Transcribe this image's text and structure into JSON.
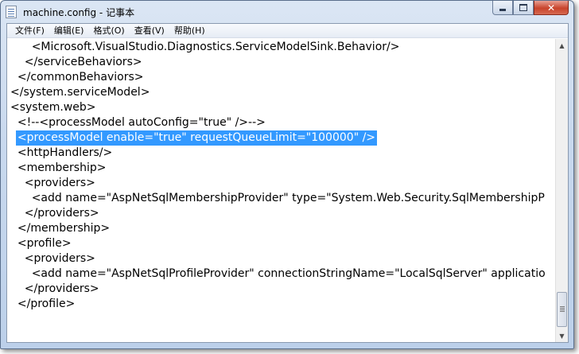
{
  "window": {
    "title": "machine.config - 记事本"
  },
  "titlebar_buttons": {
    "minimize": "minimize-icon",
    "maximize": "maximize-icon",
    "close": "close-icon"
  },
  "menu": [
    "文件(F)",
    "编辑(E)",
    "格式(O)",
    "查看(V)",
    "帮助(H)"
  ],
  "editor": {
    "lines": [
      "      <Microsoft.VisualStudio.Diagnostics.ServiceModelSink.Behavior/>",
      "    </serviceBehaviors>",
      "  </commonBehaviors>",
      "</system.serviceModel>",
      "<system.web>",
      "  <!--<processModel autoConfig=\"true\" />-->",
      "  <processModel enable=\"true\" requestQueueLimit=\"100000\" />",
      "  <httpHandlers/>",
      "  <membership>",
      "    <providers>",
      "      <add name=\"AspNetSqlMembershipProvider\" type=\"System.Web.Security.SqlMembershipP",
      "    </providers>",
      "  </membership>",
      "  <profile>",
      "    <providers>",
      "      <add name=\"AspNetSqlProfileProvider\" connectionStringName=\"LocalSqlServer\" applicatio",
      "    </providers>",
      "  </profile>"
    ],
    "selected_line": 6
  },
  "scrollbar": {
    "up": "▲",
    "down": "▼"
  },
  "colors": {
    "selection": "#3399ff",
    "close_button": "#c8432b"
  }
}
